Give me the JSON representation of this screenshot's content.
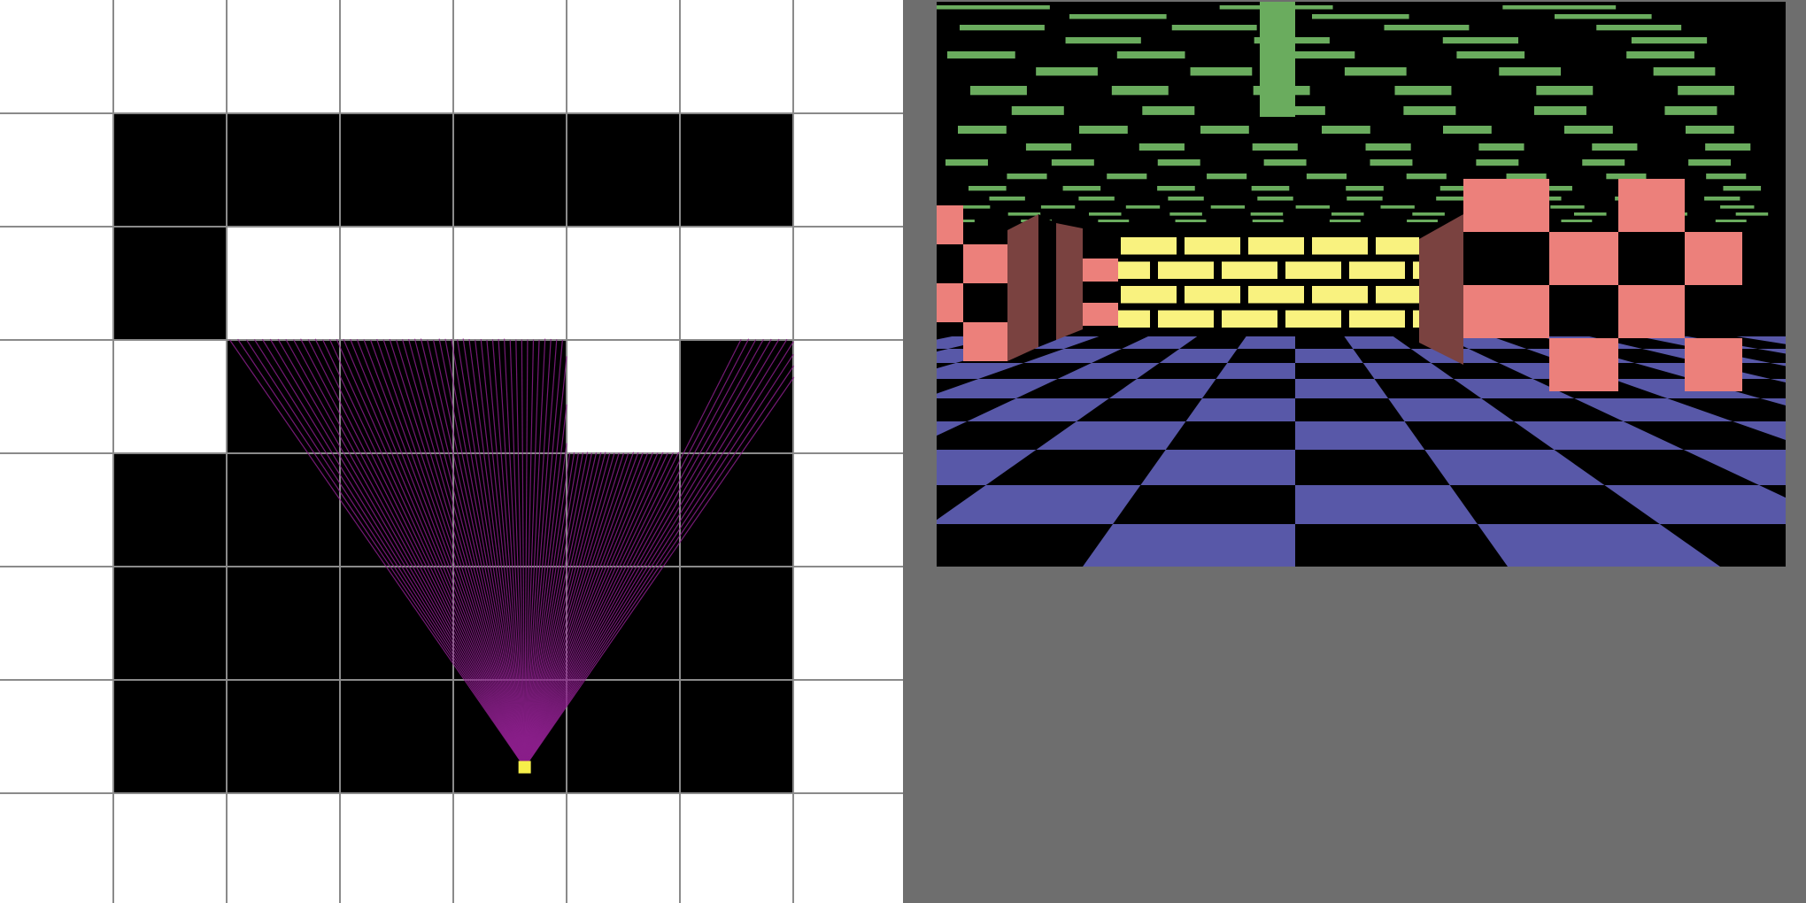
{
  "map": {
    "rows": [
      [
        0,
        0,
        0,
        0,
        0,
        0,
        0,
        0
      ],
      [
        0,
        1,
        1,
        1,
        1,
        1,
        1,
        0
      ],
      [
        0,
        1,
        0,
        0,
        0,
        0,
        0,
        0
      ],
      [
        0,
        0,
        1,
        1,
        1,
        0,
        1,
        0
      ],
      [
        0,
        1,
        1,
        1,
        1,
        1,
        1,
        0
      ],
      [
        0,
        1,
        1,
        1,
        1,
        1,
        1,
        0
      ],
      [
        0,
        1,
        1,
        1,
        1,
        1,
        1,
        0
      ],
      [
        0,
        0,
        0,
        0,
        0,
        0,
        0,
        0
      ]
    ],
    "legend": {
      "0": "open-floor",
      "1": "wall"
    }
  },
  "player": {
    "col": 4.63,
    "row": 6.77,
    "facing": "north"
  },
  "colors": {
    "floor_cell": "#ffffff",
    "wall_cell": "#000000",
    "grid_line": "#8a8a8a",
    "ray": "#8a1f8a",
    "player_marker": "#f6ef4a",
    "ceiling": "#6aac5e",
    "floor_tile": "#5858a8",
    "brick": "#f9f27f",
    "checker_wall": "#ec807b",
    "checker_shadow": "#7a4240",
    "view_background": "#000000",
    "desktop_gray": "#6e6e6e"
  },
  "render_view": {
    "textures": [
      "ceiling-tiles",
      "floor-checker",
      "yellow-brick-wall",
      "red-checker-wall"
    ]
  }
}
